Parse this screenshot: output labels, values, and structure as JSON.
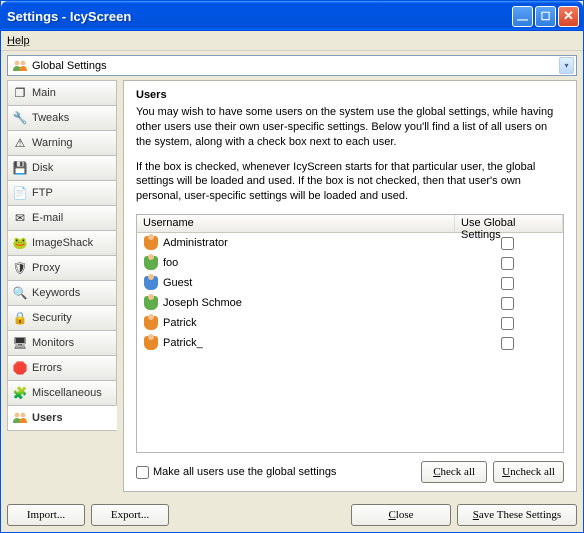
{
  "window": {
    "title": "Settings - IcyScreen"
  },
  "menu": {
    "help": "Help"
  },
  "combo": {
    "label": "Global Settings"
  },
  "sidebar": {
    "items": [
      {
        "label": "Main"
      },
      {
        "label": "Tweaks"
      },
      {
        "label": "Warning"
      },
      {
        "label": "Disk"
      },
      {
        "label": "FTP"
      },
      {
        "label": "E-mail"
      },
      {
        "label": "ImageShack"
      },
      {
        "label": "Proxy"
      },
      {
        "label": "Keywords"
      },
      {
        "label": "Security"
      },
      {
        "label": "Monitors"
      },
      {
        "label": "Errors"
      },
      {
        "label": "Miscellaneous"
      },
      {
        "label": "Users"
      }
    ]
  },
  "panel": {
    "heading": "Users",
    "p1": "You may wish to have some users on the system use the global settings, while having other users use their own user-specific settings. Below you'll find a list of all users on the system, along with a check box next to each user.",
    "p2": "If the box is checked, whenever IcyScreen starts for that particular user, the global settings will be loaded and used. If the box is not checked, then that user's own personal, user-specific settings will be loaded and used.",
    "col_username": "Username",
    "col_useglobal": "Use Global Settings",
    "rows": [
      {
        "name": "Administrator"
      },
      {
        "name": "foo"
      },
      {
        "name": "Guest"
      },
      {
        "name": "Joseph Schmoe"
      },
      {
        "name": "Patrick"
      },
      {
        "name": "Patrick_"
      }
    ],
    "make_all": "Make all users use the global settings",
    "check_all": "Check all",
    "uncheck_all": "Uncheck all"
  },
  "footer": {
    "import": "Import...",
    "export": "Export...",
    "close": "Close",
    "save": "Save These Settings"
  }
}
